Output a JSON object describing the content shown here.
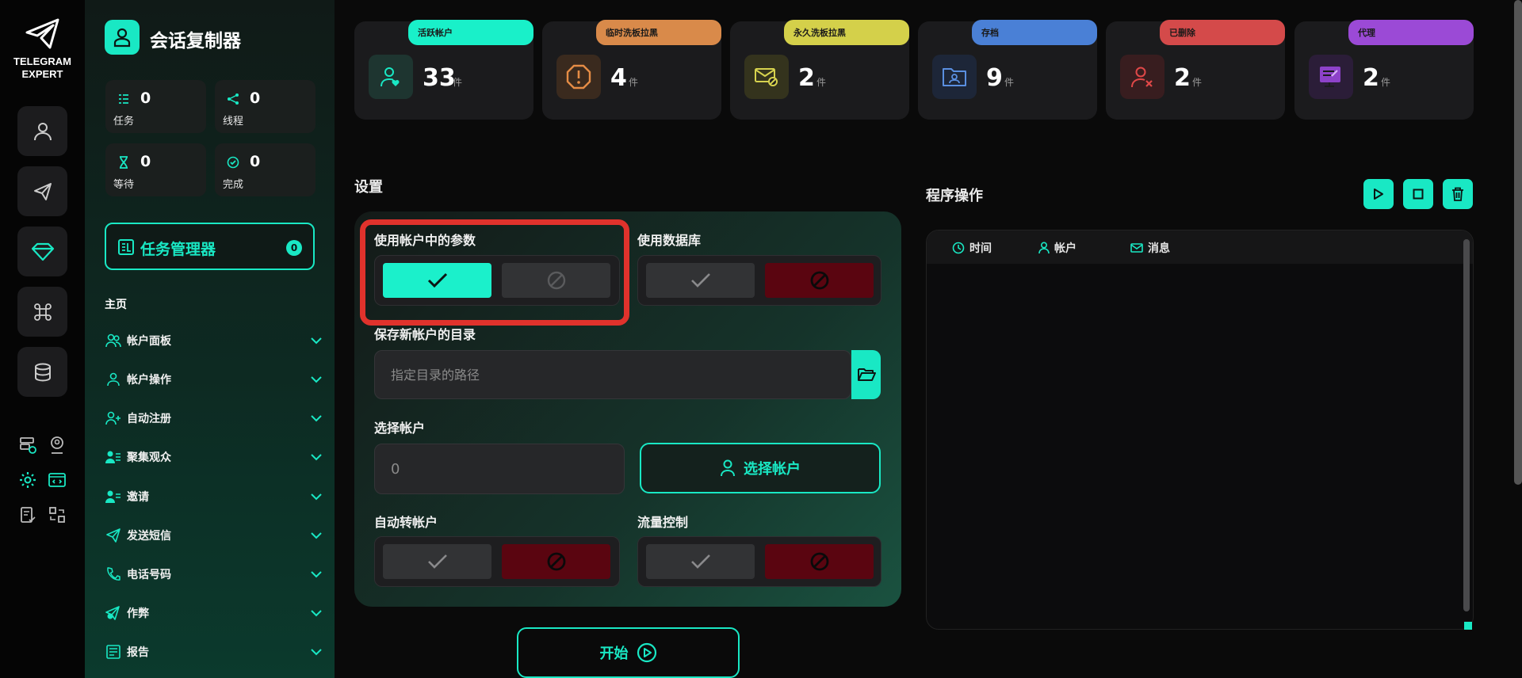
{
  "app": {
    "brand": "TELEGRAM EXPERT",
    "title": "会话复制器"
  },
  "rail": {
    "icons": [
      "user-icon",
      "send-icon",
      "diamond-icon",
      "command-icon",
      "database-icon"
    ],
    "small_icons": [
      "server-check-icon",
      "user-pin-icon",
      "gear-icon",
      "code-window-icon",
      "report-check-icon",
      "swap-icon"
    ]
  },
  "sidebar_stats": [
    {
      "value": "0",
      "label": "任务",
      "icon": "tasks-icon"
    },
    {
      "value": "0",
      "label": "线程",
      "icon": "share-icon"
    },
    {
      "value": "0",
      "label": "等待",
      "icon": "hourglass-icon"
    },
    {
      "value": "0",
      "label": "完成",
      "icon": "check-circle-icon"
    }
  ],
  "task_manager": {
    "label": "任务管理器",
    "count": "0"
  },
  "nav": {
    "home_label": "主页",
    "items": [
      {
        "label": "帐户面板",
        "icon": "users-icon"
      },
      {
        "label": "帐户操作",
        "icon": "user-icon"
      },
      {
        "label": "自动注册",
        "icon": "user-plus-icon"
      },
      {
        "label": "聚集观众",
        "icon": "user-list-icon"
      },
      {
        "label": "邀请",
        "icon": "user-invite-icon"
      },
      {
        "label": "发送短信",
        "icon": "send-icon"
      },
      {
        "label": "电话号码",
        "icon": "phone-icon"
      },
      {
        "label": "作弊",
        "icon": "send-plus-icon"
      },
      {
        "label": "报告",
        "icon": "report-icon"
      }
    ]
  },
  "top_stats": [
    {
      "tag": "活跃帐户",
      "value": "33",
      "unit": "件",
      "color": "#19e8c4"
    },
    {
      "tag": "临时洗板拉黑",
      "value": "4",
      "unit": "件",
      "color": "#d98a4a"
    },
    {
      "tag": "永久洗板拉黑",
      "value": "2",
      "unit": "件",
      "color": "#cfcc4a"
    },
    {
      "tag": "存档",
      "value": "9",
      "unit": "件",
      "color": "#4a7fd4"
    },
    {
      "tag": "已删除",
      "value": "2",
      "unit": "件",
      "color": "#d24a4a"
    },
    {
      "tag": "代理",
      "value": "2",
      "unit": "件",
      "color": "#9a4ad4"
    }
  ],
  "settings": {
    "title": "设置",
    "use_account_params": {
      "label": "使用帐户中的参数",
      "value": "on"
    },
    "use_database": {
      "label": "使用数据库",
      "value": "off"
    },
    "save_dir": {
      "label": "保存新帐户的目录",
      "placeholder": "指定目录的路径",
      "value": ""
    },
    "select_accounts": {
      "label": "选择帐户",
      "value": "0",
      "button": "选择帐户"
    },
    "auto_transfer": {
      "label": "自动转帐户",
      "value": "off"
    },
    "traffic_control": {
      "label": "流量控制",
      "value": "off"
    },
    "start_button": "开始"
  },
  "program": {
    "title": "程序操作",
    "columns": [
      {
        "label": "时间",
        "icon": "clock-icon"
      },
      {
        "label": "帐户",
        "icon": "user-icon"
      },
      {
        "label": "消息",
        "icon": "mail-icon"
      }
    ]
  },
  "colors": {
    "accent": "#19e8c4",
    "danger": "#5a0510",
    "highlight": "#e0322c"
  }
}
